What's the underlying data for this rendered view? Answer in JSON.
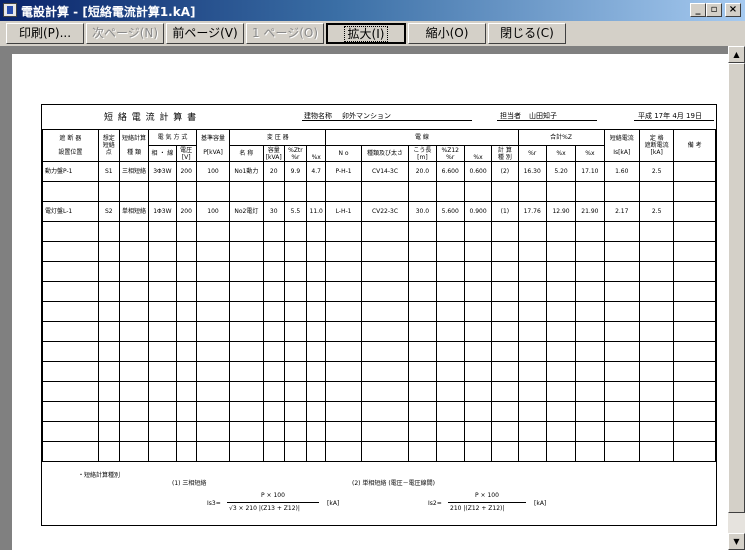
{
  "window": {
    "title": "電設計算 - [短絡電流計算1.kA]",
    "buttons": {
      "minimize": "_",
      "restore": "▫",
      "close": "×"
    }
  },
  "toolbar": {
    "print": "印刷(P)...",
    "next_page": "次ページ(N)",
    "prev_page": "前ページ(V)",
    "one_page": "1 ページ(O)",
    "zoom_in": "拡大(I)",
    "zoom_out": "縮小(O)",
    "close": "閉じる(C)"
  },
  "scrollbar": {
    "up": "▲",
    "down": "▼"
  },
  "sheet": {
    "title": "短 絡 電 流 計 算 書",
    "building_label": "建物名称",
    "building_name": "卯外マンション",
    "person_label": "担当者",
    "person_name": "山田知子",
    "date": "平成 17年  4月  19日"
  },
  "headers": {
    "breaker_location": "遮 断 器",
    "breaker_location2": "設置位置",
    "fault_point": "想定",
    "fault_point2": "短絡",
    "fault_point3": "点",
    "calc_type": "短絡計算",
    "calc_type2": "種    類",
    "elec_system": "電 気 方 式",
    "phase_wire": "相 ・ 線",
    "voltage": "電圧",
    "voltage_unit": "[V]",
    "base_capacity": "基準容量",
    "base_capacity_unit": "P[kVA]",
    "transformer": "変 圧 器",
    "name": "名  称",
    "capacity": "容量",
    "capacity_unit": "[kVA]",
    "pct_ztr": "%Ztr",
    "pct_r": "%r",
    "pct_x": "%x",
    "cable": "電          線",
    "no": "N o",
    "type_size": "種類及び太さ",
    "length": "こう長",
    "length_unit": "[m]",
    "pct_z12": "%Z12",
    "calc_kind": "計 算",
    "calc_kind2": "種 別",
    "total_z": "合計%Z",
    "short_current": "短絡電流",
    "short_current_unit": "Is[kA]",
    "rated": "定   格",
    "rated2": "遮断電流",
    "rated_unit": "[kA]",
    "remarks": "備  考"
  },
  "rows": [
    {
      "location": "動力盤P-1",
      "point": "S1",
      "type": "三相短絡",
      "phase": "3Φ3W",
      "voltage": "200",
      "base": "100",
      "tr_name": "No1動力",
      "tr_cap": "20",
      "tr_r": "9.9",
      "tr_x": "4.7",
      "cable_no": "P-H-1",
      "cable_type": "CV14-3C",
      "length": "20.0",
      "z_r": "6.600",
      "z_x": "0.600",
      "calc": "(2)",
      "tot_r": "16.30",
      "tot_x": "5.20",
      "tot_z": "17.10",
      "is": "1.60",
      "rated": "2.5"
    },
    {
      "location": "",
      "point": "",
      "type": "",
      "phase": "",
      "voltage": "",
      "base": "",
      "tr_name": "",
      "tr_cap": "",
      "tr_r": "",
      "tr_x": "",
      "cable_no": "",
      "cable_type": "",
      "length": "",
      "z_r": "",
      "z_x": "",
      "calc": "",
      "tot_r": "",
      "tot_x": "",
      "tot_z": "",
      "is": "",
      "rated": ""
    },
    {
      "location": "電灯盤L-1",
      "point": "S2",
      "type": "単相短絡",
      "phase": "1Φ3W",
      "voltage": "200",
      "base": "100",
      "tr_name": "No2電灯",
      "tr_cap": "30",
      "tr_r": "5.5",
      "tr_x": "11.0",
      "cable_no": "L-H-1",
      "cable_type": "CV22-3C",
      "length": "30.0",
      "z_r": "5.600",
      "z_x": "0.900",
      "calc": "(1)",
      "tot_r": "17.76",
      "tot_x": "12.90",
      "tot_z": "21.90",
      "is": "2.17",
      "rated": "2.5"
    }
  ],
  "empty_rows": 12,
  "footer": {
    "heading": "・短絡計算種別",
    "f1_label": "(1)  三相短絡",
    "f1_lhs": "Is3=",
    "f1_num": "P × 100",
    "f1_den": "√3 × 210 |(Z13 + Z12)|",
    "f1_unit": "[kA]",
    "f2_label": "(2)  単相短絡  (電圧－電圧線間)",
    "f2_lhs": "Is2=",
    "f2_num": "P × 100",
    "f2_den": "210 |(Z12 + Z12)|",
    "f2_unit": "[kA]"
  }
}
